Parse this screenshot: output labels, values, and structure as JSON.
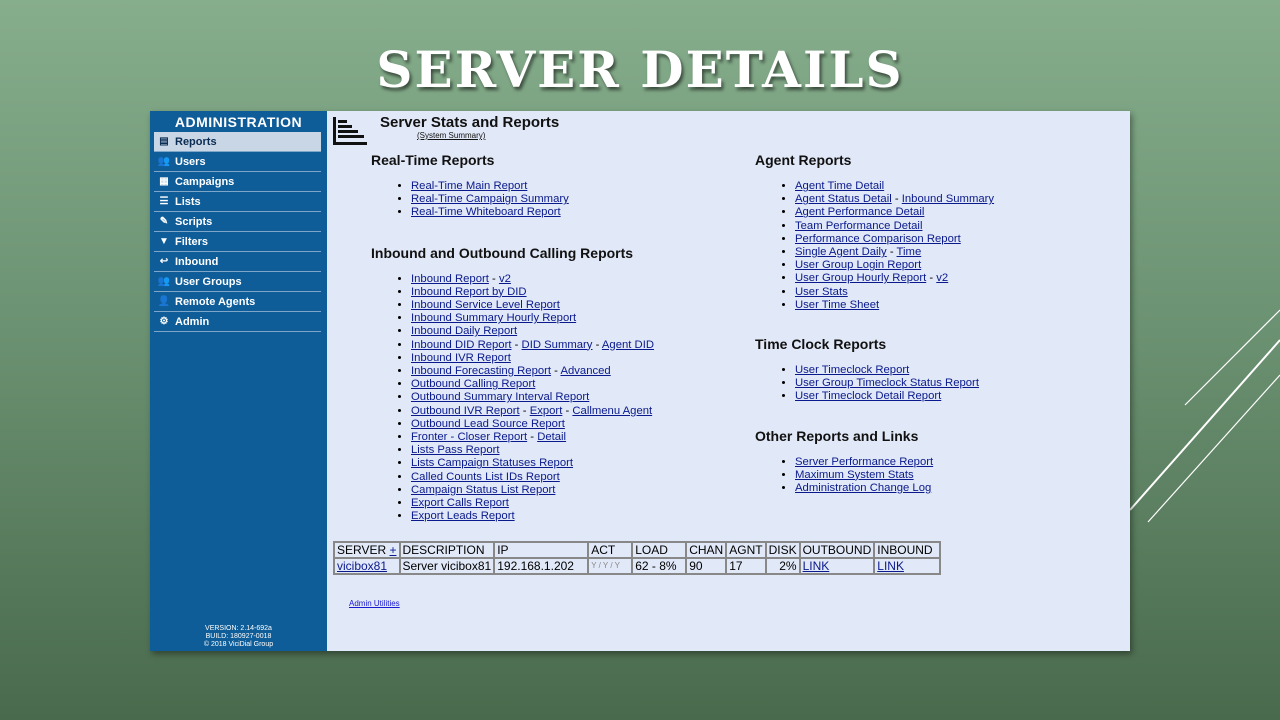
{
  "slide": {
    "title": "SERVER DETAILS"
  },
  "sidebar": {
    "title": "ADMINISTRATION",
    "items": [
      {
        "label": "Reports",
        "icon": "reports-icon",
        "active": true
      },
      {
        "label": "Users",
        "icon": "users-icon"
      },
      {
        "label": "Campaigns",
        "icon": "campaigns-icon"
      },
      {
        "label": "Lists",
        "icon": "lists-icon"
      },
      {
        "label": "Scripts",
        "icon": "scripts-icon"
      },
      {
        "label": "Filters",
        "icon": "filter-icon"
      },
      {
        "label": "Inbound",
        "icon": "inbound-icon"
      },
      {
        "label": "User Groups",
        "icon": "user-groups-icon"
      },
      {
        "label": "Remote Agents",
        "icon": "remote-agents-icon"
      },
      {
        "label": "Admin",
        "icon": "gear-icon"
      }
    ],
    "version": "VERSION: 2.14-692a",
    "build": "BUILD: 180927-0018",
    "copyright": "© 2018 ViciDial Group"
  },
  "main": {
    "title": "Server Stats and Reports",
    "subtitle": "(System Summary)",
    "realtime": {
      "title": "Real-Time Reports",
      "links": [
        "Real-Time Main Report",
        "Real-Time Campaign Summary",
        "Real-Time Whiteboard Report"
      ]
    },
    "inout": {
      "title": "Inbound and Outbound Calling Reports",
      "r0a": "Inbound Report",
      "r0b": "v2",
      "r1": "Inbound Report by DID",
      "r2": "Inbound Service Level Report",
      "r3": "Inbound Summary Hourly Report",
      "r4": "Inbound Daily Report",
      "r5a": "Inbound DID Report",
      "r5b": "DID Summary",
      "r5c": "Agent DID",
      "r6": "Inbound IVR Report",
      "r7a": "Inbound Forecasting Report",
      "r7b": "Advanced",
      "r8": "Outbound Calling Report",
      "r9": "Outbound Summary Interval Report",
      "r10a": "Outbound IVR Report",
      "r10b": "Export",
      "r10c": "Callmenu Agent",
      "r11": "Outbound Lead Source Report",
      "r12a": "Fronter - Closer Report",
      "r12b": "Detail",
      "r13": "Lists Pass Report",
      "r14": "Lists Campaign Statuses Report",
      "r15": "Called Counts List IDs Report",
      "r16": "Campaign Status List Report",
      "r17": "Export Calls Report",
      "r18": "Export Leads Report"
    },
    "agent": {
      "title": "Agent Reports",
      "a0": "Agent Time Detail",
      "a1a": "Agent Status Detail",
      "a1b": "Inbound Summary",
      "a2": "Agent Performance Detail",
      "a3": "Team Performance Detail",
      "a4": "Performance Comparison Report",
      "a5a": "Single Agent Daily",
      "a5b": "Time",
      "a6": "User Group Login Report",
      "a7a": "User Group Hourly Report",
      "a7b": "v2",
      "a8": "User Stats",
      "a9": "User Time Sheet"
    },
    "timeclock": {
      "title": "Time Clock Reports",
      "links": [
        "User Timeclock Report",
        "User Group Timeclock Status Report",
        "User Timeclock Detail Report"
      ]
    },
    "other": {
      "title": "Other Reports and Links",
      "links": [
        "Server Performance Report",
        "Maximum System Stats",
        "Administration Change Log"
      ]
    },
    "server_table": {
      "headers": [
        "SERVER",
        "+",
        "DESCRIPTION",
        "IP",
        "ACT",
        "LOAD",
        "CHAN",
        "AGNT",
        "DISK",
        "OUTBOUND",
        "INBOUND"
      ],
      "row": [
        "vicibox81",
        "Server vicibox81",
        "192.168.1.202",
        "Y / Y / Y",
        "62 - 8%",
        "90",
        "17",
        "2%",
        "LINK",
        "LINK"
      ]
    },
    "admin_utilities": "Admin Utilities"
  }
}
